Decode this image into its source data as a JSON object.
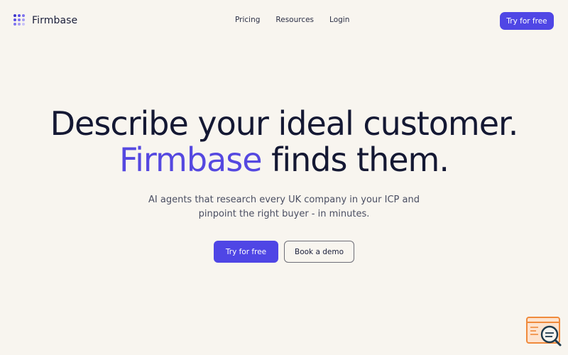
{
  "brand": {
    "name": "Firmbase",
    "logo_icon": "dot-grid-icon",
    "accent_color": "#4f46e5"
  },
  "nav": {
    "items": [
      {
        "label": "Pricing"
      },
      {
        "label": "Resources"
      },
      {
        "label": "Login"
      }
    ],
    "cta_label": "Try for free"
  },
  "hero": {
    "title_line1": "Describe your ideal customer.",
    "title_accent": "Firmbase",
    "title_line2_rest": " finds them.",
    "subtitle_line1": "AI agents that research every UK company in your ICP and",
    "subtitle_line2": "pinpoint the right buyer - in minutes.",
    "primary_cta": "Try for free",
    "secondary_cta": "Book a demo"
  },
  "widget": {
    "icon": "search-chat-widget-icon",
    "color": "#f08a3c"
  }
}
